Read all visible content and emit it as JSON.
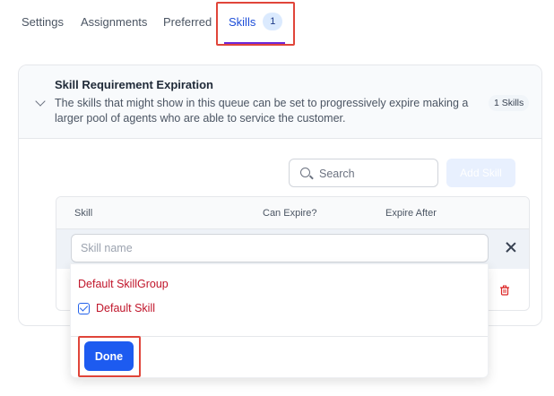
{
  "tabs": [
    {
      "label": "Settings"
    },
    {
      "label": "Assignments"
    },
    {
      "label": "Preferred"
    },
    {
      "label": "Skills",
      "count": "1",
      "active": true
    }
  ],
  "section": {
    "title": "Skill Requirement Expiration",
    "description": "The skills that might show in this queue can be set to progressively expire making a larger pool of agents who are able to service the customer.",
    "badge": "1 Skills"
  },
  "search": {
    "placeholder": "Search",
    "value": ""
  },
  "add_skill_label": "Add Skill",
  "table": {
    "columns": [
      "Skill",
      "Can Expire?",
      "Expire After"
    ],
    "skill_input_placeholder": "Skill name"
  },
  "dropdown": {
    "group_label": "Default SkillGroup",
    "options": [
      {
        "label": "Default Skill",
        "checked": true
      }
    ],
    "done_label": "Done"
  },
  "colors": {
    "accent": "#1d5bf0",
    "highlight": "#e0453a",
    "option_text": "#c0152a"
  },
  "icons": [
    "chevron-down-icon",
    "search-icon",
    "close-icon",
    "trash-icon",
    "checkbox-checked-icon"
  ]
}
